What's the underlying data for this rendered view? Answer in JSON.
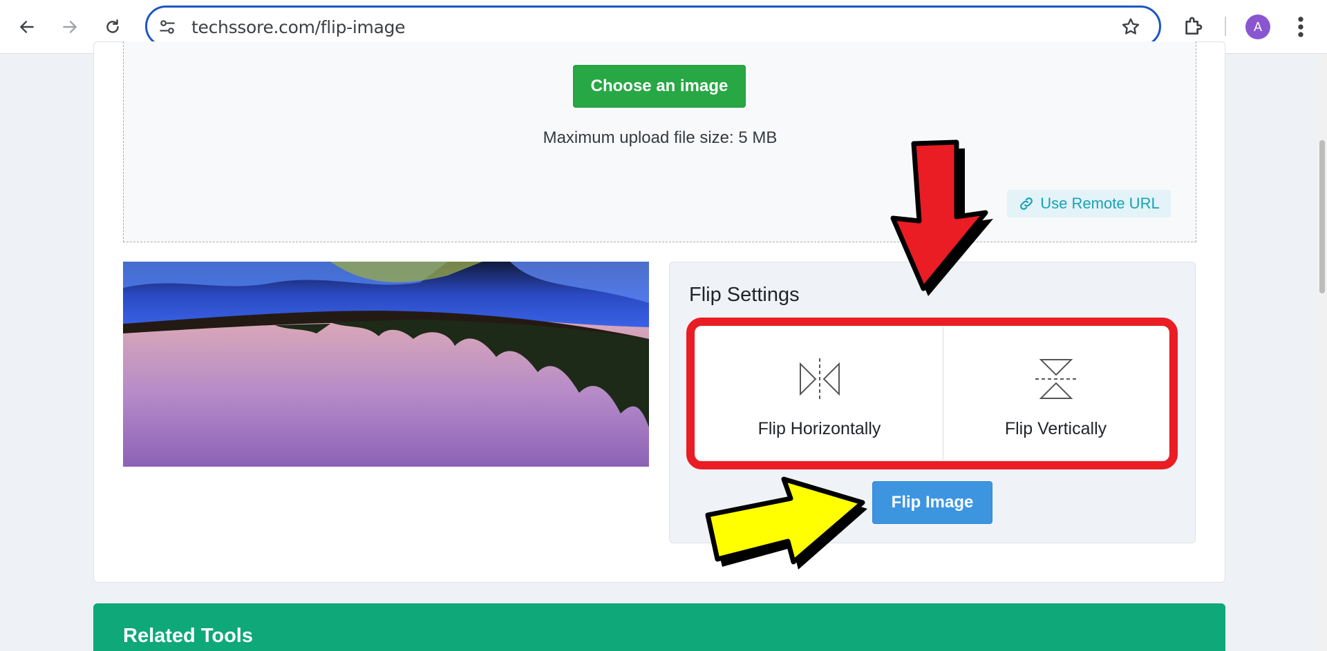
{
  "browser": {
    "url": "techssore.com/flip-image",
    "avatar_letter": "A",
    "icons": [
      "back-arrow-icon",
      "forward-arrow-icon",
      "reload-icon",
      "site-settings-icon",
      "bookmark-star-icon",
      "extensions-puzzle-icon",
      "more-vertical-icon"
    ]
  },
  "uploader": {
    "choose_label": "Choose an image",
    "max_size_text": "Maximum upload file size: 5 MB",
    "remote_url_label": "Use Remote URL"
  },
  "flip_settings": {
    "title": "Flip Settings",
    "options": [
      {
        "label": "Flip Horizontally",
        "icon": "flip-horizontal-icon"
      },
      {
        "label": "Flip Vertically",
        "icon": "flip-vertical-icon"
      }
    ],
    "submit_label": "Flip Image"
  },
  "related": {
    "title": "Related Tools"
  },
  "annotations": {
    "highlight_color": "#ea1c24",
    "red_arrow_color": "#ea1c24",
    "yellow_arrow_color": "#ffff00"
  },
  "colors": {
    "choose_button": "#28a745",
    "flip_button": "#3d95e0",
    "remote_url_text": "#17a2b8",
    "related_banner": "#0fa878"
  }
}
